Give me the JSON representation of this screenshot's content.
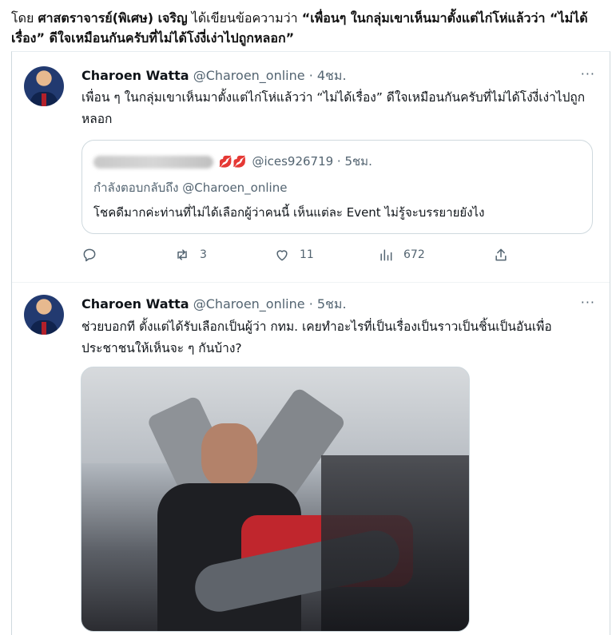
{
  "caption": {
    "prefix": "โดย",
    "author": "ศาสตราจารย์(พิเศษ) เจริญ",
    "middle": "ได้เขียนข้อความว่า",
    "quote": "“เพื่อนๆ ในกลุ่มเขาเห็นมาตั้งแต่ไก่โห่แล้วว่า “ไม่ได้เรื่อง” ดีใจเหมือนกันครับที่ไม่ได้โง่งี่เง่าไปถูกหลอก”"
  },
  "tweet1": {
    "name": "Charoen Watta",
    "handle": "@Charoen_online · 4ชม.",
    "more": "···",
    "text": "เพื่อน ๆ ในกลุ่มเขาเห็นมาตั้งแต่ไก่โห่แล้วว่า “ไม่ได้เรื่อง” ดีใจเหมือนกันครับที่ไม่ได้โง่งี่เง่าไปถูกหลอก",
    "quote": {
      "emoji": "💋💋",
      "handle": "@ices926719 · 5ชม.",
      "reply_to": "กำลังตอบกลับถึง @Charoen_online",
      "text": "โชคดีมากค่ะท่านที่ไม่ได้เลือกผู้ว่าคนนี้ เห็นแต่ละ Event ไม่รู้จะบรรยายยังไง"
    },
    "actions": {
      "retweets": "3",
      "likes": "11",
      "views": "672"
    }
  },
  "tweet2": {
    "name": "Charoen Watta",
    "handle": "@Charoen_online · 5ชม.",
    "more": "···",
    "text": "ช่วยบอกที ตั้งแต่ได้รับเลือกเป็นผู้ว่า กทม. เคยทำอะไรที่เป็นเรื่องเป็นราวเป็นชิ้นเป็นอันเพื่อประชาชนให้เห็นจะ ๆ กันบ้าง?"
  }
}
